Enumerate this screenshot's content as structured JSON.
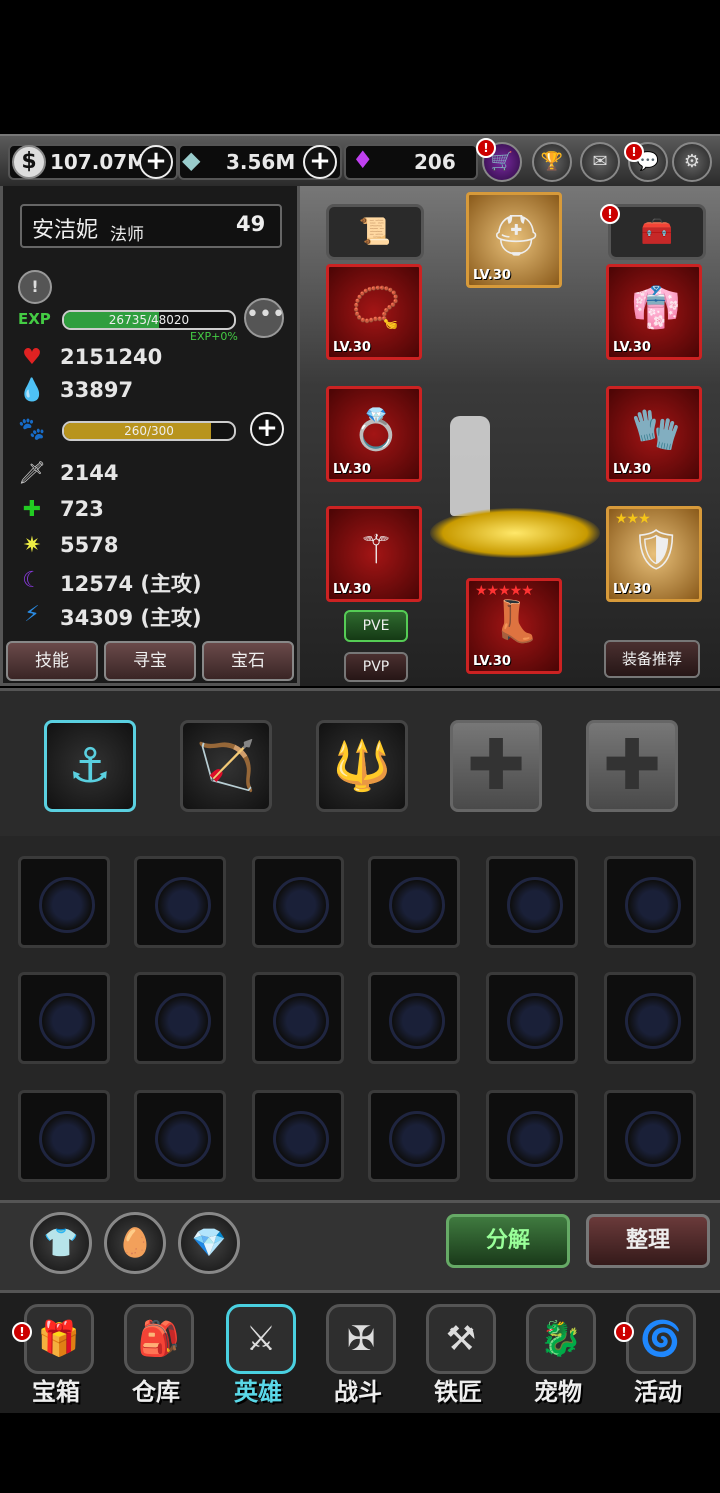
{
  "resources": {
    "coins": "107.07M",
    "crystals": "3.56M",
    "gems": "206"
  },
  "top_icons": [
    "shop-cart-icon",
    "trophy-icon",
    "mail-icon",
    "chat-icon",
    "settings-icon"
  ],
  "hero": {
    "name": "安洁妮",
    "class": "法师",
    "level": "49",
    "exp_text": "26735/48020",
    "exp_fraction": 0.557,
    "exp_bonus": "EXP+0%",
    "exp_label": "EXP",
    "hp": "2151240",
    "mp": "33897",
    "pet_text": "260/300",
    "pet_fraction": 0.867,
    "attack": "2144",
    "defense": "723",
    "light": "5578",
    "dark": "12574 (主攻)",
    "lightning": "34309 (主攻)"
  },
  "left_buttons": [
    "技能",
    "寻宝",
    "宝石"
  ],
  "equipment": {
    "helmet_lv": "LV.30",
    "necklace_lv": "LV.30",
    "armor_lv": "LV.30",
    "ring_lv": "LV.30",
    "gloves_lv": "LV.30",
    "weapon_lv": "LV.30",
    "shield_lv": "LV.30",
    "boots_lv": "LV.30",
    "shield_stars": "★★★",
    "boots_stars": "★★★★★"
  },
  "mode_buttons": {
    "pve": "PVE",
    "pvp": "PVP"
  },
  "recommend_button": "装备推荐",
  "actions": {
    "decompose": "分解",
    "sort": "整理"
  },
  "nav": [
    "宝箱",
    "仓库",
    "英雄",
    "战斗",
    "铁匠",
    "宠物",
    "活动"
  ],
  "colors": {
    "exp_fill": "#2f9e3e",
    "pet_fill": "#b8941e",
    "hp": "#e02222",
    "mp": "#1f6fe0",
    "nav_active": "#4ad0e0"
  }
}
